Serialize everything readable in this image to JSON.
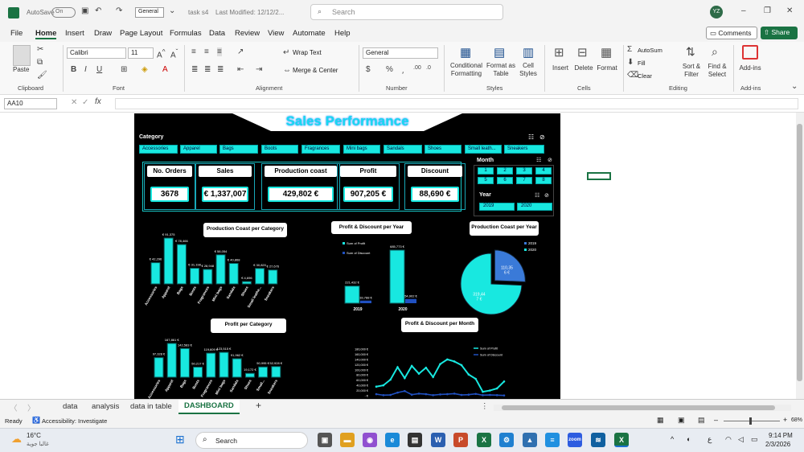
{
  "titlebar": {
    "autosave": "AutoSave",
    "autosave_state": "On",
    "style": "General",
    "doc": "task s4",
    "modified": "Last Modified: 12/12/2...",
    "search_placeholder": "Search",
    "user": "YZ"
  },
  "menu": [
    "File",
    "Home",
    "Insert",
    "Draw",
    "Page Layout",
    "Formulas",
    "Data",
    "Review",
    "View",
    "Automate",
    "Help"
  ],
  "comments": "Comments",
  "share": "Share",
  "ribbon": {
    "paste": "Paste",
    "clipboard": "Clipboard",
    "font_name": "Calibri",
    "font_size": "11",
    "font": "Font",
    "wrap": "Wrap Text",
    "merge": "Merge & Center",
    "alignment": "Alignment",
    "number_format": "General",
    "number": "Number",
    "cond": "Conditional",
    "cond2": "Formatting",
    "fmt_table": "Format as",
    "fmt_table2": "Table",
    "cell_styles": "Cell",
    "cell_styles2": "Styles",
    "styles": "Styles",
    "insert": "Insert",
    "delete": "Delete",
    "format": "Format",
    "cells": "Cells",
    "autosum": "AutoSum",
    "fill": "Fill",
    "clear": "Clear",
    "sort": "Sort &",
    "sort2": "Filter",
    "find": "Find &",
    "find2": "Select",
    "editing": "Editing",
    "addins": "Add-ins",
    "addins_g": "Add-ins"
  },
  "namebox": "AA10",
  "dashboard": {
    "title": "Sales Performance",
    "category_label": "Category",
    "categories": [
      "Accessories",
      "Apparel",
      "Bags",
      "Boots",
      "Fragrances",
      "Mini bags",
      "Sandals",
      "Shoes",
      "Small leath...",
      "Sneakers"
    ],
    "kpis": [
      {
        "label": "No. Orders",
        "value": "3678"
      },
      {
        "label": "Sales",
        "value": "€ 1,337,007"
      },
      {
        "label": "Production coast",
        "value": "429,802 €"
      },
      {
        "label": "Profit",
        "value": "907,205 €"
      },
      {
        "label": "Discount",
        "value": "88,690 €"
      }
    ],
    "month_label": "Month",
    "months": [
      "1",
      "2",
      "3",
      "4",
      "5",
      "6",
      "7",
      "8"
    ],
    "year_label": "Year",
    "years": [
      "2019",
      "2020"
    ],
    "chart_titles": {
      "prod_cat": "Production Coast per Category",
      "pd_year": "Profit & Discount per Year",
      "prod_year": "Production Coast per Year",
      "profit_cat": "Profit per Category",
      "pd_month": "Profit & Discount per Month"
    }
  },
  "chart_data": [
    {
      "type": "bar",
      "title": "Production Coast per Category",
      "categories": [
        "Accessories",
        "Apparel",
        "Bags",
        "Boots",
        "Fragrances",
        "Mini bags",
        "Sandals",
        "Shoes",
        "Small leathe...",
        "Sneakers"
      ],
      "values": [
        42296,
        91375,
        78466,
        31198,
        28948,
        58054,
        40868,
        4696,
        30820,
        27676
      ],
      "labels": [
        "€ 42,296",
        "€ 91,375",
        "€ 78,466",
        "€ 31,198",
        "€ 28,948",
        "€ 58,054",
        "€ 40,868",
        "€ 4,696",
        "€ 30,820",
        "€ 27,676"
      ]
    },
    {
      "type": "bar",
      "title": "Profit & Discount per Year",
      "categories": [
        "2019",
        "2020"
      ],
      "series": [
        {
          "name": "Sum of Profit",
          "values": [
            221432,
            685773
          ],
          "labels": [
            "221,432 €",
            "685,773 €"
          ]
        },
        {
          "name": "Sum of Discount",
          "values": [
            33788,
            54902
          ],
          "labels": [
            "33,788 €",
            "54,902 €"
          ]
        }
      ]
    },
    {
      "type": "pie",
      "title": "Production Coast per Year",
      "legend": [
        "2019",
        "2020"
      ],
      "values": [
        110350,
        319440
      ],
      "labels": [
        "110,35 6 €",
        "319,44 7 €"
      ]
    },
    {
      "type": "bar",
      "title": "Profit per Category",
      "categories": [
        "Accessories",
        "Apparel",
        "Bags",
        "Boots",
        "Fragrances",
        "Mini bags",
        "Sandals",
        "Shoes",
        "Small...",
        "Sneakers"
      ],
      "values": [
        97328,
        167861,
        142583,
        50217,
        119609,
        123515,
        91962,
        19172,
        50995,
        52928
      ],
      "labels": [
        "97,328 €",
        "167,861 €",
        "142,583 €",
        "50,217 €",
        "119,609 €",
        "123,515 €",
        "91,962 €",
        "19,172 €",
        "50,995 €",
        "52,928 €"
      ]
    },
    {
      "type": "line",
      "title": "Profit & Discount per Month",
      "ytick_labels": [
        "- €",
        "20,000 €",
        "40,000 €",
        "60,000 €",
        "80,000 €",
        "100,000 €",
        "120,000 €",
        "140,000 €",
        "160,000 €",
        "180,000 €"
      ],
      "ylim": [
        0,
        180000
      ],
      "series": [
        {
          "name": "Sum of Profit",
          "values": [
            35000,
            40000,
            62000,
            110000,
            68000,
            115000,
            85000,
            108000,
            72000,
            122000,
            140000,
            132000,
            118000,
            82000,
            65000,
            15000,
            20000,
            28000,
            55000
          ]
        },
        {
          "name": "Sum of Discount",
          "values": [
            6000,
            2000,
            3000,
            12000,
            18000,
            4000,
            8000,
            6000,
            2000,
            5000,
            6000,
            8000,
            3000,
            4000,
            7000,
            2000,
            3000,
            2000,
            1000
          ]
        }
      ]
    }
  ],
  "sheets": [
    "data",
    "analysis",
    "data in table",
    "DASHBOARD"
  ],
  "status": {
    "ready": "Ready",
    "accessibility": "Accessibility: Investigate",
    "zoom": "68%"
  },
  "taskbar": {
    "temp": "16°C",
    "weather": "غالبا جوية",
    "search": "Search",
    "time": "9:14 PM",
    "date": "2/3/2026"
  }
}
